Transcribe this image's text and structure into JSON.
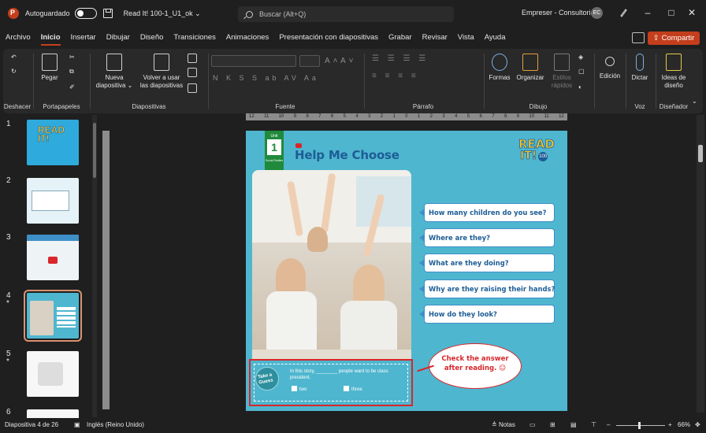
{
  "titlebar": {
    "autosave_label": "Autoguardado",
    "doc_title": "Read It! 100-1_U1_ok ⌄",
    "search_placeholder": "Buscar (Alt+Q)",
    "user_name": "Empreser - Consultoria",
    "avatar_initials": "EC",
    "minimize": "–",
    "restore": "□",
    "close": "✕"
  },
  "menu": {
    "items": [
      "Archivo",
      "Inicio",
      "Insertar",
      "Dibujar",
      "Diseño",
      "Transiciones",
      "Animaciones",
      "Presentación con diapositivas",
      "Grabar",
      "Revisar",
      "Vista",
      "Ayuda"
    ],
    "active": "Inicio",
    "share_label": "Compartir"
  },
  "ribbon": {
    "undo_group": "Deshacer",
    "clipboard_group": "Portapapeles",
    "paste_label": "Pegar",
    "slides_group": "Diapositivas",
    "new_slide_label": "Nueva",
    "new_slide_label2": "diapositiva ⌄",
    "reuse_label": "Volver a usar",
    "reuse_label2": "las diapositivas",
    "font_group": "Fuente",
    "font_size_up": "A˄",
    "font_size_down": "A˅",
    "format_row": "N K S S ab AV Aa",
    "paragraph_group": "Párrafo",
    "drawing_group": "Dibujo",
    "shapes_label": "Formas",
    "arrange_label": "Organizar",
    "quick_styles_label": "Estilos",
    "quick_styles_label2": "rápidos",
    "editing_label": "Edición",
    "voice_group": "Voz",
    "dictate_label": "Dictar",
    "designer_group": "Diseñador",
    "design_ideas_label": "Ideas de",
    "design_ideas_label2": "diseño"
  },
  "thumbnails": [
    {
      "num": "1",
      "marker": ""
    },
    {
      "num": "2",
      "marker": ""
    },
    {
      "num": "3",
      "marker": ""
    },
    {
      "num": "4",
      "marker": "*"
    },
    {
      "num": "5",
      "marker": "*"
    },
    {
      "num": "6",
      "marker": ""
    }
  ],
  "ruler_top": [
    "12",
    "11",
    "10",
    "9",
    "8",
    "7",
    "6",
    "5",
    "4",
    "3",
    "2",
    "1",
    "0",
    "1",
    "2",
    "3",
    "4",
    "5",
    "6",
    "7",
    "8",
    "9",
    "10",
    "11",
    "12"
  ],
  "slide": {
    "unit_label": "Unit",
    "unit_number": "1",
    "unit_subtitle": "Social Studies",
    "title": "Help Me Choose",
    "logo_line1": "READ",
    "logo_line2": "IT!",
    "logo_badge": "100",
    "questions": [
      "How many children do you see?",
      "Where are they?",
      "What are they doing?",
      "Why are they raising their hands?",
      "How do they look?"
    ],
    "bubble_line1": "Check the answer",
    "bubble_line2": "after reading. ☺",
    "take_guess_line1": "Take a",
    "take_guess_line2": "Guess",
    "story_text": "In this story, ________ people want to be class president.",
    "option1": "two",
    "option2": "three",
    "page_number": "4"
  },
  "status": {
    "slide_info": "Diapositiva 4 de 26",
    "language": "Inglés (Reino Unido)",
    "notes_label": "Notas",
    "zoom_minus": "–",
    "zoom_plus": "+",
    "zoom_level": "66%"
  },
  "colors": {
    "accent": "#c43e1c",
    "slide_bg": "#4fb6cf",
    "title_blue": "#1d5d95",
    "red_callout": "#d8262a"
  }
}
